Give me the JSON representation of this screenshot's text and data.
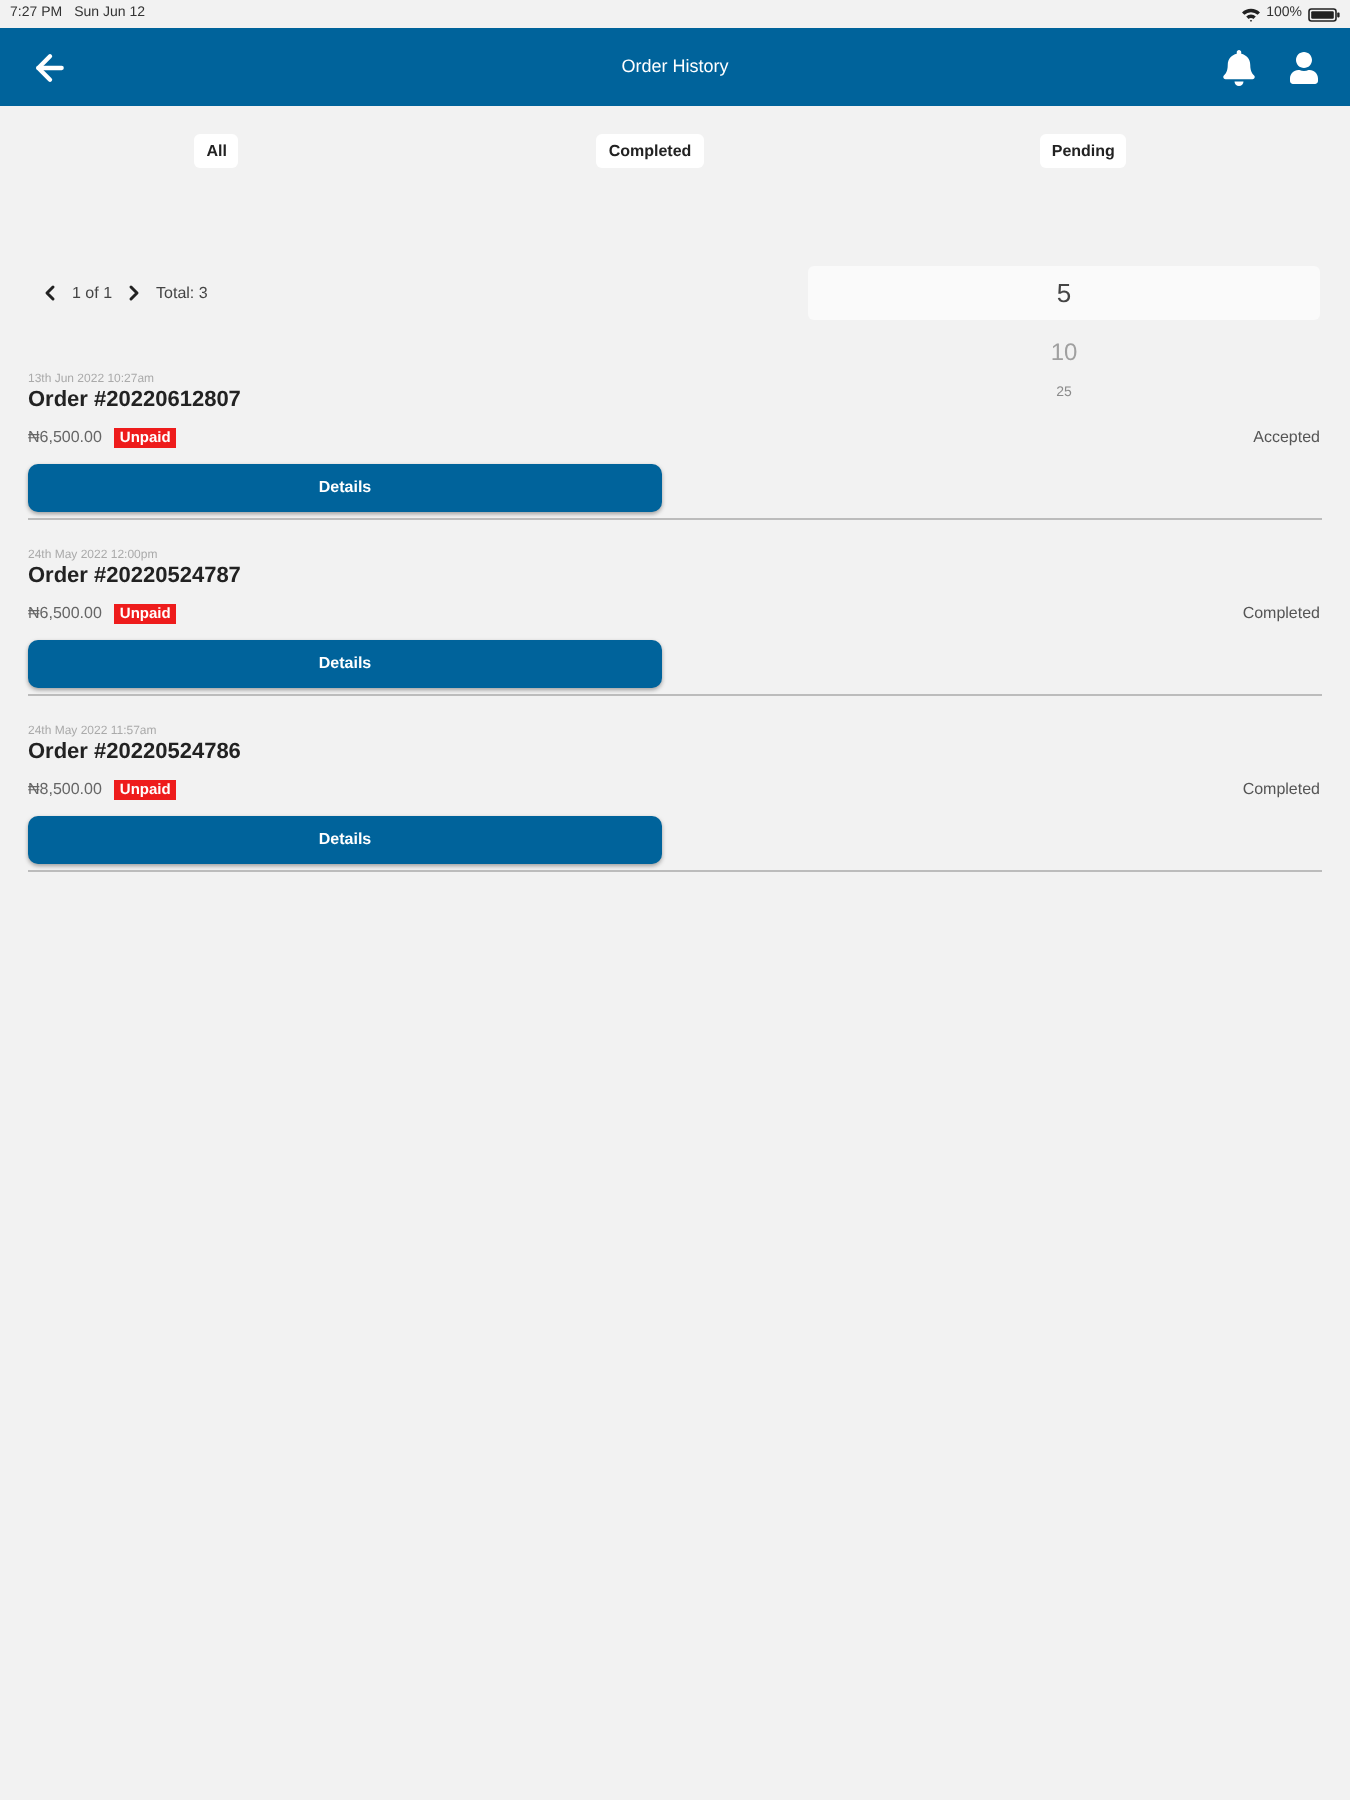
{
  "status_bar": {
    "time": "7:27 PM",
    "date": "Sun Jun 12",
    "battery": "100%"
  },
  "header": {
    "title": "Order History"
  },
  "tabs": [
    {
      "label": "All"
    },
    {
      "label": "Completed"
    },
    {
      "label": "Pending"
    }
  ],
  "pagination": {
    "page": "1 of 1",
    "total": "Total: 3"
  },
  "page_size_picker": {
    "options": [
      {
        "label": "5",
        "selected": true
      },
      {
        "label": "10",
        "selected": false
      },
      {
        "label": "25",
        "selected": false
      }
    ]
  },
  "orders": [
    {
      "date": "13th Jun 2022 10:27am",
      "title": "Order #20220612807",
      "amount": "₦6,500.00",
      "payment_badge": "Unpaid",
      "status": "Accepted",
      "button": "Details"
    },
    {
      "date": "24th May 2022 12:00pm",
      "title": "Order #20220524787",
      "amount": "₦6,500.00",
      "payment_badge": "Unpaid",
      "status": "Completed",
      "button": "Details"
    },
    {
      "date": "24th May 2022 11:57am",
      "title": "Order #20220524786",
      "amount": "₦8,500.00",
      "payment_badge": "Unpaid",
      "status": "Completed",
      "button": "Details"
    }
  ]
}
